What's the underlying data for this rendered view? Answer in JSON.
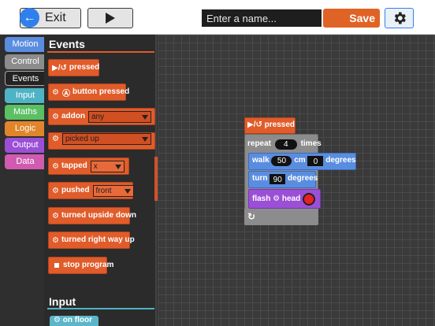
{
  "topbar": {
    "exit_label": "Exit",
    "name_placeholder": "Enter a name...",
    "name_value": "",
    "save_label": "Save"
  },
  "tabs": [
    {
      "label": "Motion",
      "color": "#5a8de0"
    },
    {
      "label": "Control",
      "color": "#8c8c8c"
    },
    {
      "label": "Events",
      "color": "#e05c2b",
      "active": true
    },
    {
      "label": "Input",
      "color": "#4fb3c6"
    },
    {
      "label": "Maths",
      "color": "#5bbf63"
    },
    {
      "label": "Logic",
      "color": "#e0852b"
    },
    {
      "label": "Output",
      "color": "#9b4fd6"
    },
    {
      "label": "Data",
      "color": "#d05bb0"
    }
  ],
  "palette": {
    "events_title": "Events",
    "input_title": "Input",
    "blocks": {
      "pressed": "pressed",
      "button_pressed": "button pressed",
      "addon": "addon",
      "addon_value": "any",
      "picked_up_value": "picked up",
      "tapped": "tapped",
      "tapped_value": "x",
      "pushed": "pushed",
      "pushed_value": "front",
      "turned_upside_down": "turned upside down",
      "turned_right_way_up": "turned right way up",
      "stop_program": "stop program"
    },
    "input_blocks": {
      "on_floor": "on floor"
    }
  },
  "workspace": {
    "hat_label": "pressed",
    "repeat_label": "repeat",
    "repeat_count": "4",
    "repeat_times": "times",
    "walk_label": "walk",
    "walk_value": "50",
    "walk_unit": "cm",
    "walk_angle": "0",
    "walk_degrees": "degrees",
    "turn_label": "turn",
    "turn_value": "90",
    "turn_degrees": "degrees",
    "flash_label": "flash",
    "flash_target": "head",
    "flash_color": "#e82020"
  },
  "colors": {
    "events": "#e05c2b",
    "control": "#8c8c8c",
    "motion": "#5a8de0",
    "output": "#9b4fd6",
    "save": "#e06326"
  }
}
